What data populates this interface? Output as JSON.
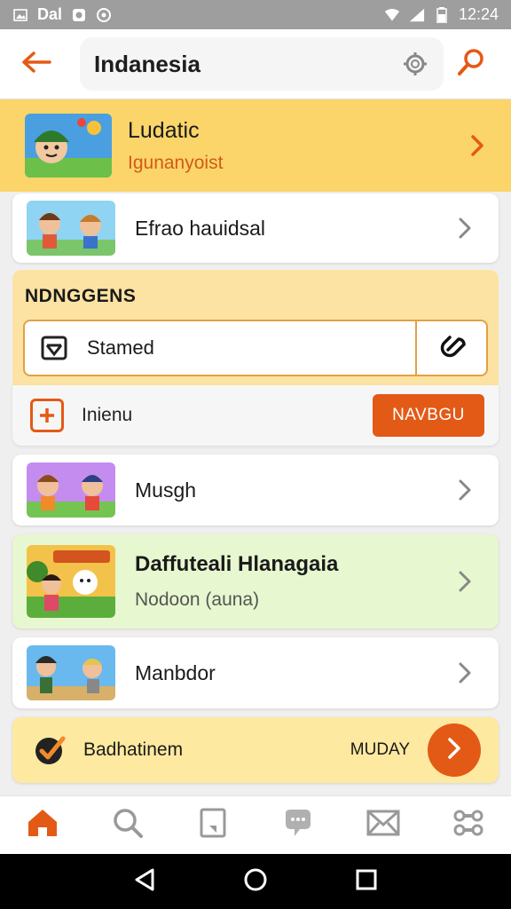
{
  "status_bar": {
    "left_text": "Dal",
    "time": "12:24"
  },
  "header": {
    "title": "Indanesia",
    "back_icon": "back-arrow-icon",
    "search_icon": "search-icon"
  },
  "featured": {
    "title": "Ludatic",
    "subtitle": "Igunanyoist"
  },
  "list1": {
    "label": "Efrao hauidsal"
  },
  "section": {
    "heading": "NDNGGENS",
    "shared_label": "Stamed"
  },
  "action": {
    "label": "Inienu",
    "button_label": "NAVBGU"
  },
  "list2": {
    "label": "Musgh"
  },
  "green_card": {
    "title": "Daffuteali Hlanagaia",
    "subtitle": "Nodoon (auna)"
  },
  "list3": {
    "label": "Manbdor"
  },
  "bottom_card": {
    "label": "Badhatinem",
    "right_text": "MUDAY"
  },
  "colors": {
    "accent": "#e35a16",
    "featured_bg": "#fbd56a",
    "green_bg": "#e7f7cf",
    "yellow_bg": "#fde9a0"
  },
  "tabs": [
    "home-icon",
    "search-icon",
    "bookmark-icon",
    "chat-icon",
    "mail-icon",
    "grid-icon"
  ]
}
